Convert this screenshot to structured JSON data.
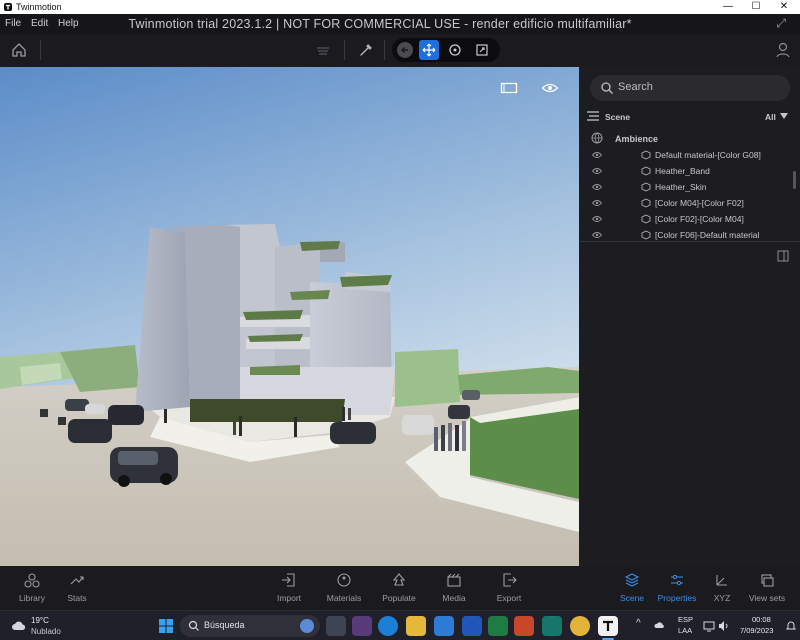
{
  "window": {
    "app_name": "Twinmotion",
    "minimize": "—",
    "maximize": "☐",
    "close": "✕"
  },
  "menu": {
    "items": [
      "File",
      "Edit",
      "Help"
    ],
    "doc_title": "Twinmotion trial 2023.1.2 | NOT FOR COMMERCIAL USE - render edificio multifamiliar*"
  },
  "panel": {
    "search_placeholder": "Search",
    "scene_label": "Scene",
    "filter_label": "All",
    "group_label": "Ambience",
    "items": [
      "Default material-[Color G08]",
      "Heather_Band",
      "Heather_Skin",
      "[Color M04]-[Color F02]",
      "[Color F02]-[Color M04]",
      "[Color F06]-Default material"
    ]
  },
  "bottombar": {
    "left": [
      {
        "label": "Library",
        "icon": "library-icon"
      },
      {
        "label": "Stats",
        "icon": "stats-icon"
      }
    ],
    "center": [
      {
        "label": "Import",
        "icon": "import-icon"
      },
      {
        "label": "Materials",
        "icon": "materials-icon"
      },
      {
        "label": "Populate",
        "icon": "populate-icon"
      },
      {
        "label": "Media",
        "icon": "media-icon"
      },
      {
        "label": "Export",
        "icon": "export-icon"
      }
    ],
    "right": [
      {
        "label": "Scene",
        "icon": "scene-icon",
        "active": true
      },
      {
        "label": "Properties",
        "icon": "properties-icon",
        "active": true
      },
      {
        "label": "XYZ",
        "icon": "xyz-icon"
      },
      {
        "label": "View sets",
        "icon": "viewsets-icon"
      }
    ]
  },
  "taskbar": {
    "weather_temp": "19°C",
    "weather_desc": "Nublado",
    "search_label": "Búsqueda",
    "lang_top": "ESP",
    "lang_bottom": "LAA",
    "time": "00:08",
    "date": "7/09/2023"
  },
  "colors": {
    "accent": "#1e6fd9",
    "active_label": "#3d8ee8",
    "sky_top": "#5f8fc9",
    "ground": "#c9c3b6"
  }
}
